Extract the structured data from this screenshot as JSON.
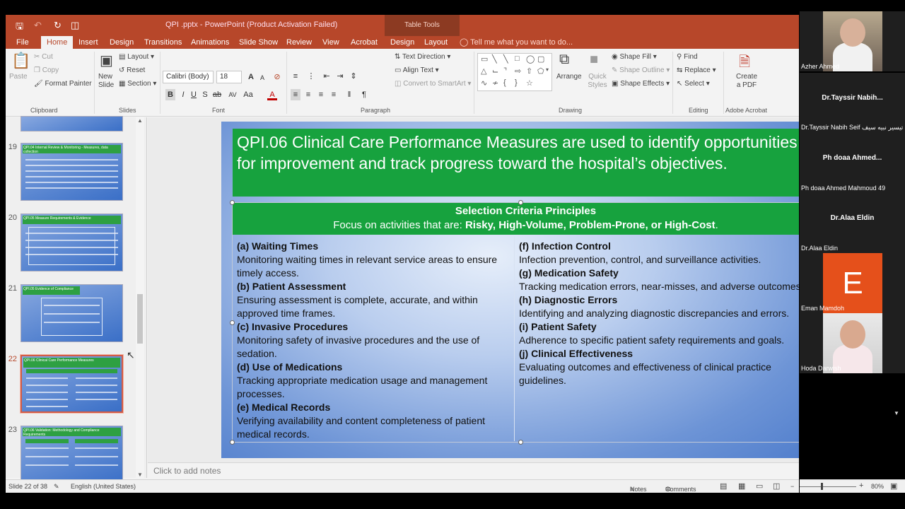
{
  "window": {
    "title": "QPI .pptx - PowerPoint (Product Activation Failed)",
    "table_tools": "Table Tools"
  },
  "tabs": [
    "File",
    "Home",
    "Insert",
    "Design",
    "Transitions",
    "Animations",
    "Slide Show",
    "Review",
    "View",
    "Acrobat",
    "Design",
    "Layout"
  ],
  "tell_me": "Tell me what you want to do...",
  "ribbon": {
    "clipboard": {
      "paste": "Paste",
      "cut": "Cut",
      "copy": "Copy",
      "format_painter": "Format Painter",
      "label": "Clipboard"
    },
    "slides": {
      "new_slide": "New Slide",
      "layout": "Layout",
      "reset": "Reset",
      "section": "Section",
      "label": "Slides"
    },
    "font": {
      "name": "Calibri (Body)",
      "size": "18",
      "label": "Font"
    },
    "paragraph": {
      "text_direction": "Text Direction",
      "align_text": "Align Text",
      "convert_smartart": "Convert to SmartArt",
      "label": "Paragraph"
    },
    "drawing": {
      "arrange": "Arrange",
      "quick_styles": "Quick Styles",
      "shape_fill": "Shape Fill",
      "shape_outline": "Shape Outline",
      "shape_effects": "Shape Effects",
      "label": "Drawing"
    },
    "editing": {
      "find": "Find",
      "replace": "Replace",
      "select": "Select",
      "label": "Editing"
    },
    "acrobat": {
      "create_pdf": "Create a PDF",
      "label": "Adobe Acrobat"
    }
  },
  "thumbnails": [
    {
      "num": "19",
      "heading": "QPI.04 Internal Review & Monitoring - Measures, data collection"
    },
    {
      "num": "20",
      "heading": "QPI.05 Measure Requirements & Evidence"
    },
    {
      "num": "21",
      "heading": "QPI.05 Evidence of Compliance"
    },
    {
      "num": "22",
      "heading": "QPI.06 Clinical Care Performance Measures"
    },
    {
      "num": "23",
      "heading": "QPI.06 Validation: Methodology and Compliance Requirements"
    }
  ],
  "slide": {
    "title": "QPI.06 Clinical Care Performance Measures are used to identify opportunities for improvement and track progress toward the hospital’s objectives.",
    "header": "Selection Criteria Principles",
    "focus_prefix": "Focus on activities that are: ",
    "focus_bold": "Risky, High-Volume, Problem-Prone, or High-Cost",
    "focus_suffix": ".",
    "left": [
      {
        "t": "(a) Waiting Times",
        "d": "Monitoring waiting times in relevant service areas to ensure timely access."
      },
      {
        "t": "(b) Patient Assessment",
        "d": "Ensuring assessment is complete, accurate, and within approved time frames."
      },
      {
        "t": "(c) Invasive Procedures",
        "d": "Monitoring safety of invasive procedures and the use of sedation."
      },
      {
        "t": "(d) Use of Medications",
        "d": "Tracking appropriate medication usage and management processes."
      },
      {
        "t": "(e) Medical Records",
        "d": "Verifying availability and content completeness of patient medical records."
      }
    ],
    "right": [
      {
        "t": "(f) Infection Control",
        "d": "Infection prevention, control, and surveillance activities."
      },
      {
        "t": "(g) Medication Safety",
        "d": "Tracking medication errors, near-misses, and adverse outcomes."
      },
      {
        "t": "(h) Diagnostic Errors",
        "d": "Identifying and analyzing diagnostic discrepancies and errors."
      },
      {
        "t": "(i) Patient Safety",
        "d": "Adherence to specific patient safety requirements and goals."
      },
      {
        "t": "(j) Clinical Effectiveness",
        "d": "Evaluating outcomes and effectiveness of clinical practice guidelines."
      }
    ]
  },
  "notes_placeholder": "Click to add notes",
  "status": {
    "slide": "Slide 22 of 38",
    "language": "English (United States)",
    "notes": "Notes",
    "comments": "Comments",
    "zoom": "80%"
  },
  "participants": [
    {
      "name": "Azher Ahmed",
      "type": "video"
    },
    {
      "name": "Dr.Tayssir Nabih Seif د تيسير نبيه سيف",
      "center": "Dr.Tayssir  Nabih...",
      "type": "name"
    },
    {
      "name": "Ph doaa Ahmed Mahmoud 49",
      "center": "Ph doaa Ahmed...",
      "type": "name"
    },
    {
      "name": "Dr.Alaa Eldin",
      "center": "Dr.Alaa Eldin",
      "type": "name"
    },
    {
      "name": "Eman Mamdoh",
      "initial": "E",
      "type": "avatar"
    },
    {
      "name": "Hoda Darwish",
      "type": "video"
    }
  ],
  "colors": {
    "ppt_red": "#b7472a",
    "slide_green": "#17a23e",
    "avatar_orange": "#e5501b"
  }
}
